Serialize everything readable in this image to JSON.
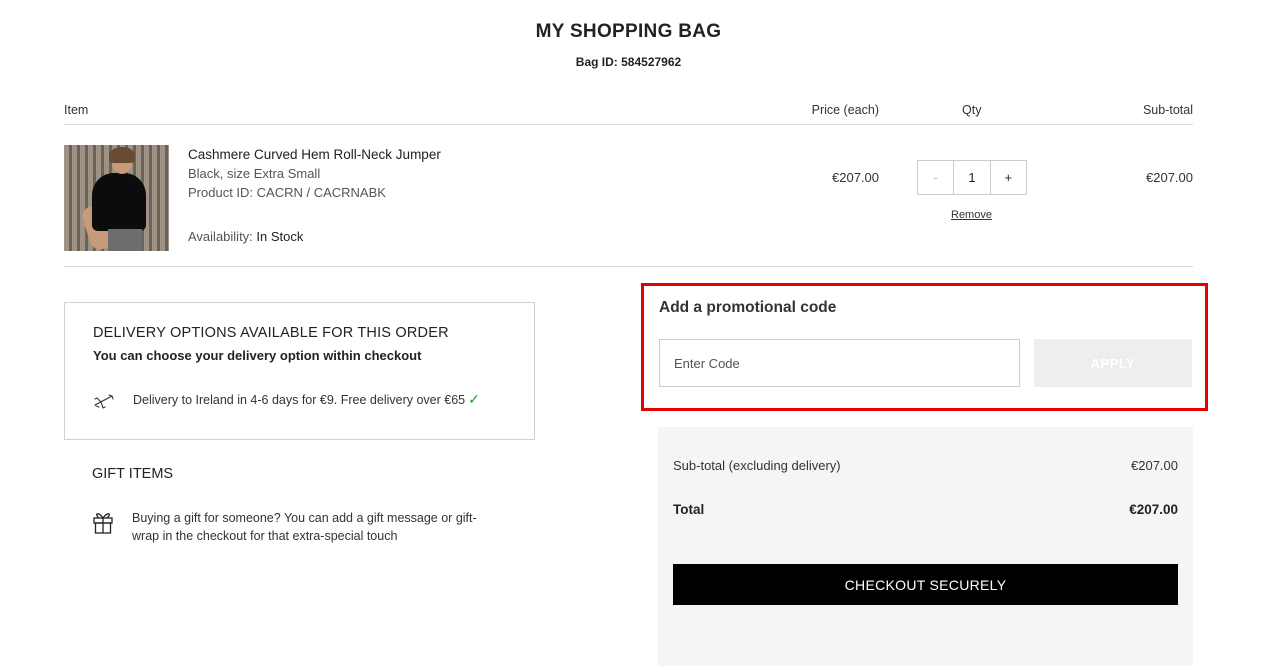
{
  "header": {
    "title": "MY SHOPPING BAG",
    "bag_id": "Bag ID: 584527962"
  },
  "table": {
    "columns": {
      "item": "Item",
      "price": "Price (each)",
      "qty": "Qty",
      "subtotal": "Sub-total"
    },
    "items": [
      {
        "name": "Cashmere Curved Hem Roll-Neck Jumper",
        "variant": "Black, size Extra Small",
        "product_id": "Product ID: CACRN / CACRNABK",
        "availability_label": "Availability:",
        "availability_value": "In Stock",
        "price": "€207.00",
        "qty_minus": "-",
        "qty": "1",
        "qty_plus": "+",
        "remove": "Remove",
        "subtotal": "€207.00"
      }
    ]
  },
  "delivery": {
    "title": "DELIVERY OPTIONS AVAILABLE FOR THIS ORDER",
    "subtitle": "You can choose your delivery option within checkout",
    "option": "Delivery to Ireland in 4-6 days for €9. Free delivery over €65",
    "check": "✓"
  },
  "gift": {
    "title": "GIFT ITEMS",
    "text": "Buying a gift for someone? You can add a gift message or gift-wrap in the checkout for that extra-special touch"
  },
  "promo": {
    "title": "Add a promotional code",
    "placeholder": "Enter Code",
    "value": "",
    "apply_label": "APPLY",
    "highlight_color": "#e60000"
  },
  "summary": {
    "subtotal_label": "Sub-total (excluding delivery)",
    "subtotal_value": "€207.00",
    "total_label": "Total",
    "total_value": "€207.00",
    "checkout_label": "CHECKOUT SECURELY"
  }
}
